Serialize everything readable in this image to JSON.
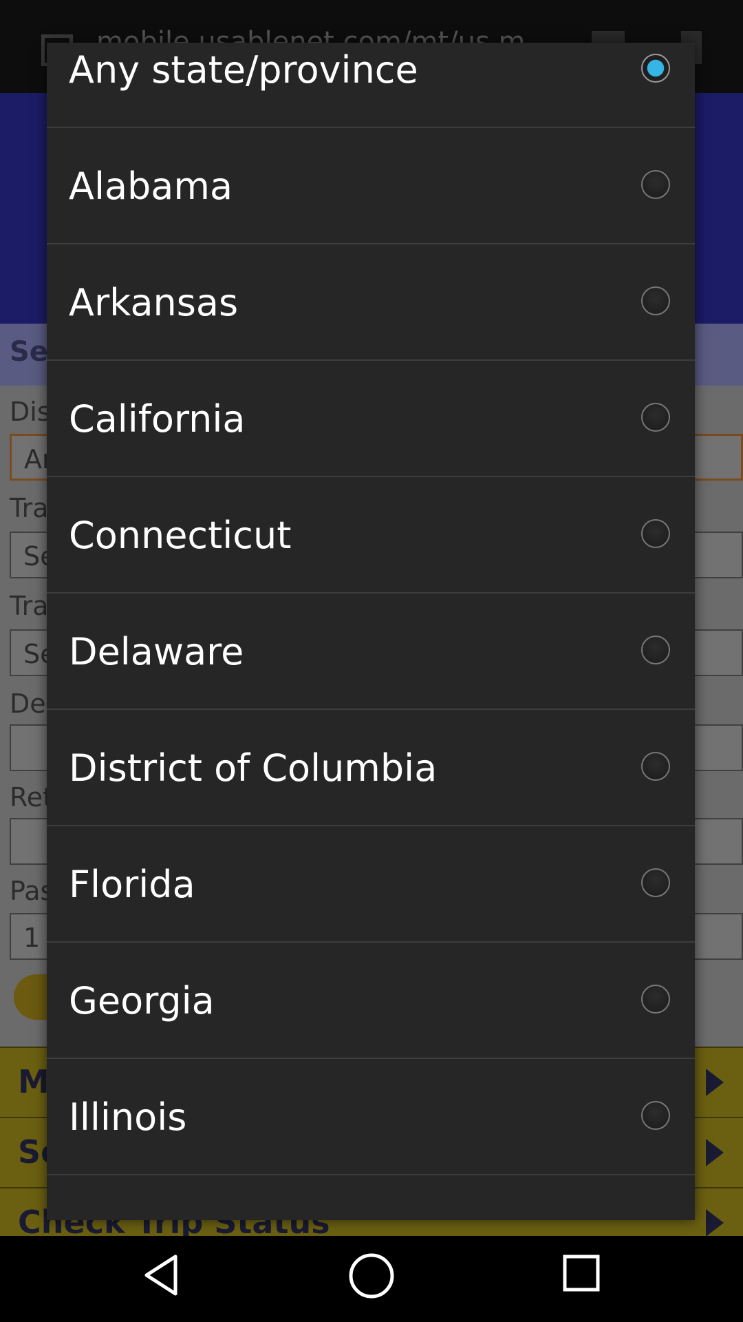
{
  "background_page": {
    "url_text": "mobile.usablenet.com/mt/us.m",
    "section_title": "Se",
    "labels": [
      "Dis",
      "Tra",
      "Tra",
      "De",
      "Ret",
      "Pas"
    ],
    "field_values": [
      "Ar",
      "Se",
      "Se",
      "",
      "",
      "1"
    ],
    "footer_items": [
      "M",
      "Se",
      "Check Trip Status"
    ]
  },
  "dialog": {
    "options": [
      {
        "label": "Any state/province",
        "checked": true
      },
      {
        "label": "Alabama",
        "checked": false
      },
      {
        "label": "Arkansas",
        "checked": false
      },
      {
        "label": "California",
        "checked": false
      },
      {
        "label": "Connecticut",
        "checked": false
      },
      {
        "label": "Delaware",
        "checked": false
      },
      {
        "label": "District of Columbia",
        "checked": false
      },
      {
        "label": "Florida",
        "checked": false
      },
      {
        "label": "Georgia",
        "checked": false
      },
      {
        "label": "Illinois",
        "checked": false
      }
    ]
  },
  "navbar": {
    "buttons": [
      {
        "icon": "back-triangle-icon"
      },
      {
        "icon": "home-circle-icon"
      },
      {
        "icon": "recents-square-icon"
      }
    ]
  },
  "colors": {
    "accent": "#34b5e5",
    "dialog_bg": "#262626",
    "divider": "#3d3d3d"
  }
}
